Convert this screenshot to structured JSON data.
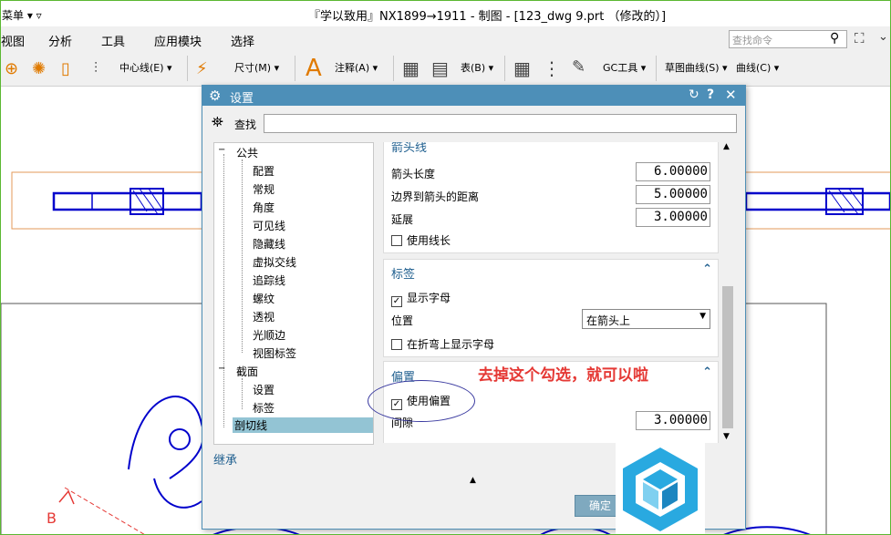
{
  "window": {
    "menu_label": "菜单 ▾ ▿",
    "title": "『学以致用』NX1899→1911 - 制图 - [123_dwg 9.prt （修改的）]"
  },
  "menubar": {
    "items": [
      "视图",
      "分析",
      "工具",
      "应用模块",
      "选择"
    ],
    "search_placeholder": "查找命令"
  },
  "toolbar": {
    "centerline": "中心线(E) ▾",
    "dimension": "尺寸(M) ▾",
    "annotation": "注释(A) ▾",
    "table": "表(B) ▾",
    "gc_tools": "GC工具 ▾",
    "sketch_curve": "草图曲线(S) ▾",
    "curve": "曲线(C) ▾"
  },
  "dialog": {
    "title": "设置",
    "find_label": "查找",
    "find_value": "",
    "tree": [
      {
        "label": "公共",
        "level": 0,
        "toggle": "−"
      },
      {
        "label": "配置",
        "level": 1
      },
      {
        "label": "常规",
        "level": 1
      },
      {
        "label": "角度",
        "level": 1
      },
      {
        "label": "可见线",
        "level": 1
      },
      {
        "label": "隐藏线",
        "level": 1
      },
      {
        "label": "虚拟交线",
        "level": 1
      },
      {
        "label": "追踪线",
        "level": 1
      },
      {
        "label": "螺纹",
        "level": 1
      },
      {
        "label": "透视",
        "level": 1
      },
      {
        "label": "光顺边",
        "level": 1
      },
      {
        "label": "视图标签",
        "level": 1
      },
      {
        "label": "截面",
        "level": 0,
        "toggle": "−"
      },
      {
        "label": "设置",
        "level": 1
      },
      {
        "label": "标签",
        "level": 1
      },
      {
        "label": "剖切线",
        "level": 0,
        "selected": true
      }
    ],
    "arrow_section": {
      "header": "箭头线",
      "arrow_length_label": "箭头长度",
      "arrow_length": "6.00000",
      "border_dist_label": "边界到箭头的距离",
      "border_dist": "5.00000",
      "extend_label": "延展",
      "extend": "3.00000",
      "use_line_length": "使用线长"
    },
    "label_section": {
      "header": "标签",
      "show_letter": "显示字母",
      "position_label": "位置",
      "position_value": "在箭头上",
      "show_on_bend": "在折弯上显示字母"
    },
    "offset_section": {
      "header": "偏置",
      "use_offset": "使用偏置",
      "gap_label": "间隙",
      "gap": "3.00000"
    },
    "inherit_label": "继承",
    "ok_label": "确定"
  },
  "annotation_text": "去掉这个勾选，就可以啦",
  "drawing_label_b": "B",
  "colors": {
    "title_bar": "#4d8fb8",
    "annotation": "#e53935",
    "geometry": "#0000cc"
  }
}
